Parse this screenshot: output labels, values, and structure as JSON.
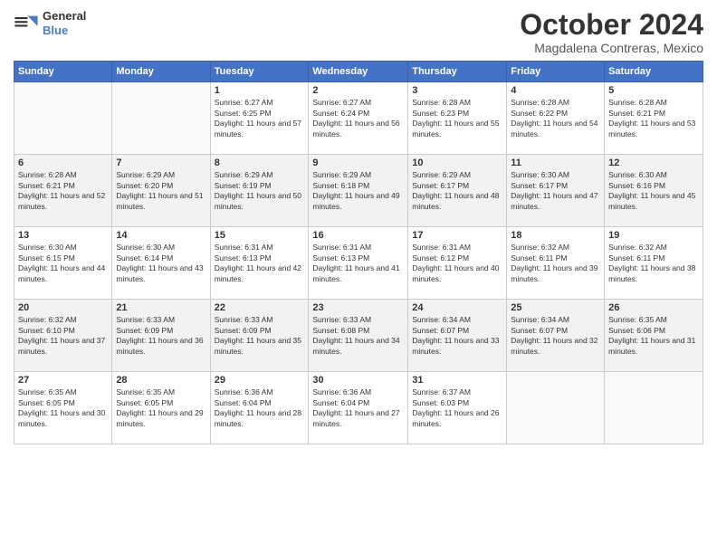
{
  "logo": {
    "line1": "General",
    "line2": "Blue"
  },
  "title": "October 2024",
  "subtitle": "Magdalena Contreras, Mexico",
  "days_of_week": [
    "Sunday",
    "Monday",
    "Tuesday",
    "Wednesday",
    "Thursday",
    "Friday",
    "Saturday"
  ],
  "weeks": [
    [
      {
        "day": "",
        "info": ""
      },
      {
        "day": "",
        "info": ""
      },
      {
        "day": "1",
        "info": "Sunrise: 6:27 AM\nSunset: 6:25 PM\nDaylight: 11 hours and 57 minutes."
      },
      {
        "day": "2",
        "info": "Sunrise: 6:27 AM\nSunset: 6:24 PM\nDaylight: 11 hours and 56 minutes."
      },
      {
        "day": "3",
        "info": "Sunrise: 6:28 AM\nSunset: 6:23 PM\nDaylight: 11 hours and 55 minutes."
      },
      {
        "day": "4",
        "info": "Sunrise: 6:28 AM\nSunset: 6:22 PM\nDaylight: 11 hours and 54 minutes."
      },
      {
        "day": "5",
        "info": "Sunrise: 6:28 AM\nSunset: 6:21 PM\nDaylight: 11 hours and 53 minutes."
      }
    ],
    [
      {
        "day": "6",
        "info": "Sunrise: 6:28 AM\nSunset: 6:21 PM\nDaylight: 11 hours and 52 minutes."
      },
      {
        "day": "7",
        "info": "Sunrise: 6:29 AM\nSunset: 6:20 PM\nDaylight: 11 hours and 51 minutes."
      },
      {
        "day": "8",
        "info": "Sunrise: 6:29 AM\nSunset: 6:19 PM\nDaylight: 11 hours and 50 minutes."
      },
      {
        "day": "9",
        "info": "Sunrise: 6:29 AM\nSunset: 6:18 PM\nDaylight: 11 hours and 49 minutes."
      },
      {
        "day": "10",
        "info": "Sunrise: 6:29 AM\nSunset: 6:17 PM\nDaylight: 11 hours and 48 minutes."
      },
      {
        "day": "11",
        "info": "Sunrise: 6:30 AM\nSunset: 6:17 PM\nDaylight: 11 hours and 47 minutes."
      },
      {
        "day": "12",
        "info": "Sunrise: 6:30 AM\nSunset: 6:16 PM\nDaylight: 11 hours and 45 minutes."
      }
    ],
    [
      {
        "day": "13",
        "info": "Sunrise: 6:30 AM\nSunset: 6:15 PM\nDaylight: 11 hours and 44 minutes."
      },
      {
        "day": "14",
        "info": "Sunrise: 6:30 AM\nSunset: 6:14 PM\nDaylight: 11 hours and 43 minutes."
      },
      {
        "day": "15",
        "info": "Sunrise: 6:31 AM\nSunset: 6:13 PM\nDaylight: 11 hours and 42 minutes."
      },
      {
        "day": "16",
        "info": "Sunrise: 6:31 AM\nSunset: 6:13 PM\nDaylight: 11 hours and 41 minutes."
      },
      {
        "day": "17",
        "info": "Sunrise: 6:31 AM\nSunset: 6:12 PM\nDaylight: 11 hours and 40 minutes."
      },
      {
        "day": "18",
        "info": "Sunrise: 6:32 AM\nSunset: 6:11 PM\nDaylight: 11 hours and 39 minutes."
      },
      {
        "day": "19",
        "info": "Sunrise: 6:32 AM\nSunset: 6:11 PM\nDaylight: 11 hours and 38 minutes."
      }
    ],
    [
      {
        "day": "20",
        "info": "Sunrise: 6:32 AM\nSunset: 6:10 PM\nDaylight: 11 hours and 37 minutes."
      },
      {
        "day": "21",
        "info": "Sunrise: 6:33 AM\nSunset: 6:09 PM\nDaylight: 11 hours and 36 minutes."
      },
      {
        "day": "22",
        "info": "Sunrise: 6:33 AM\nSunset: 6:09 PM\nDaylight: 11 hours and 35 minutes."
      },
      {
        "day": "23",
        "info": "Sunrise: 6:33 AM\nSunset: 6:08 PM\nDaylight: 11 hours and 34 minutes."
      },
      {
        "day": "24",
        "info": "Sunrise: 6:34 AM\nSunset: 6:07 PM\nDaylight: 11 hours and 33 minutes."
      },
      {
        "day": "25",
        "info": "Sunrise: 6:34 AM\nSunset: 6:07 PM\nDaylight: 11 hours and 32 minutes."
      },
      {
        "day": "26",
        "info": "Sunrise: 6:35 AM\nSunset: 6:06 PM\nDaylight: 11 hours and 31 minutes."
      }
    ],
    [
      {
        "day": "27",
        "info": "Sunrise: 6:35 AM\nSunset: 6:05 PM\nDaylight: 11 hours and 30 minutes."
      },
      {
        "day": "28",
        "info": "Sunrise: 6:35 AM\nSunset: 6:05 PM\nDaylight: 11 hours and 29 minutes."
      },
      {
        "day": "29",
        "info": "Sunrise: 6:36 AM\nSunset: 6:04 PM\nDaylight: 11 hours and 28 minutes."
      },
      {
        "day": "30",
        "info": "Sunrise: 6:36 AM\nSunset: 6:04 PM\nDaylight: 11 hours and 27 minutes."
      },
      {
        "day": "31",
        "info": "Sunrise: 6:37 AM\nSunset: 6:03 PM\nDaylight: 11 hours and 26 minutes."
      },
      {
        "day": "",
        "info": ""
      },
      {
        "day": "",
        "info": ""
      }
    ]
  ]
}
